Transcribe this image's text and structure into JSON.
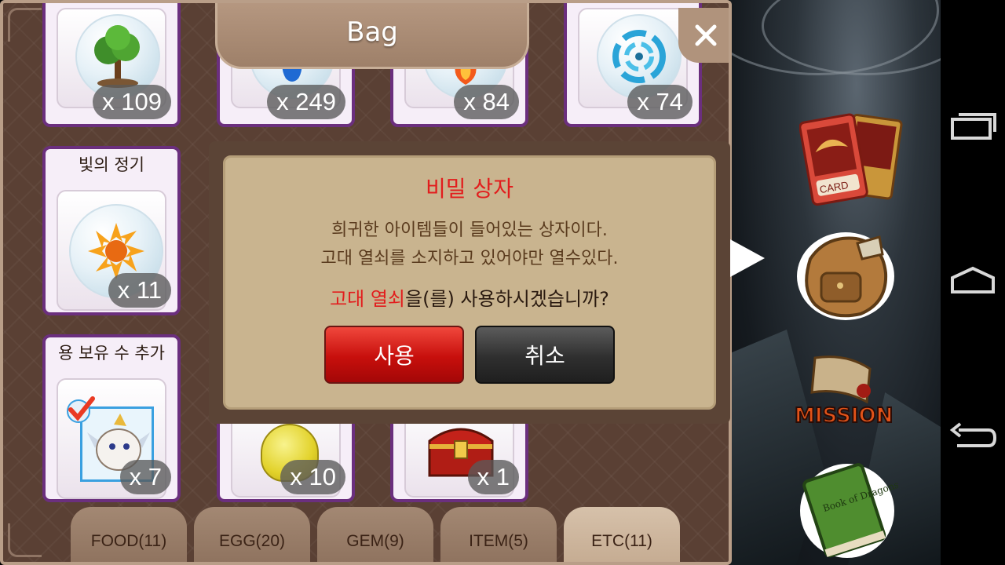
{
  "bag": {
    "title": "Bag",
    "items": [
      {
        "name": "",
        "count": "x 109",
        "icon": "tree-orb-icon"
      },
      {
        "name": "",
        "count": "x 249",
        "icon": "water-orb-icon"
      },
      {
        "name": "",
        "count": "x 84",
        "icon": "fire-orb-icon"
      },
      {
        "name": "",
        "count": "x 74",
        "icon": "wind-orb-icon"
      },
      {
        "name": "빛의 정기",
        "count": "x 11",
        "icon": "light-orb-icon"
      },
      {
        "name": "용 보유 수 추가",
        "count": "x 7",
        "icon": "dragon-slot-icon"
      },
      {
        "name": "",
        "count": "x 10",
        "icon": "potion-icon"
      },
      {
        "name": "",
        "count": "x 1",
        "icon": "treasure-chest-icon"
      }
    ],
    "tabs": [
      {
        "label": "FOOD(11)",
        "active": false
      },
      {
        "label": "EGG(20)",
        "active": false
      },
      {
        "label": "GEM(9)",
        "active": false
      },
      {
        "label": "ITEM(5)",
        "active": false
      },
      {
        "label": "ETC(11)",
        "active": true
      }
    ]
  },
  "dialog": {
    "title": "비밀 상자",
    "line1": "희귀한 아이템들이 들어있는 상자이다.",
    "line2": "고대 열쇠를 소지하고 있어야만 열수있다.",
    "question_highlight": "고대 열쇠",
    "question_rest": "을(를) 사용하시겠습니까?",
    "use_label": "사용",
    "cancel_label": "취소"
  },
  "side_menu": {
    "card_label": "CARD",
    "mission_label": "MISSION",
    "book_label": "Book of Dragons"
  },
  "colors": {
    "accent_red": "#e21d1d",
    "panel_brown": "#5a4034",
    "card_border": "#6b2f7e"
  }
}
